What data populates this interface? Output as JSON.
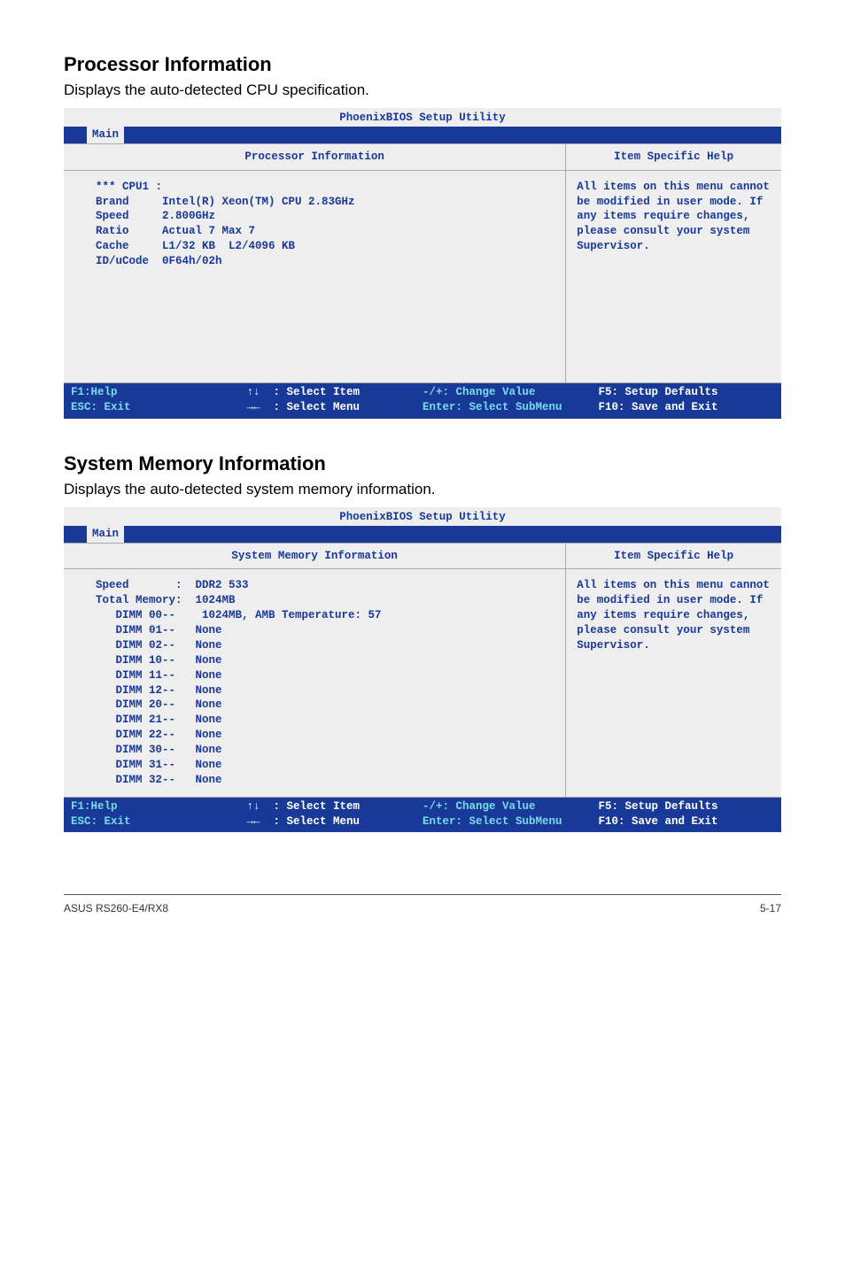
{
  "section1": {
    "heading": "Processor Information",
    "desc": "Displays the auto-detected CPU specification.",
    "bios_title": "PhoenixBIOS Setup Utility",
    "tab": "Main",
    "left_header": "Processor Information",
    "right_header": "Item Specific Help",
    "content": "*** CPU1 :\nBrand     Intel(R) Xeon(TM) CPU 2.83GHz\nSpeed     2.800GHz\nRatio     Actual 7 Max 7\nCache     L1/32 KB  L2/4096 KB\nID/uCode  0F64h/02h\n\n\n\n\n\n\n\n",
    "help": "All items on this menu cannot be modified in user mode. If any items require changes, please consult your system Supervisor."
  },
  "section2": {
    "heading": "System Memory Information",
    "desc": "Displays the auto-detected system memory information.",
    "bios_title": "PhoenixBIOS Setup Utility",
    "tab": "Main",
    "left_header": "System Memory Information",
    "right_header": "Item Specific Help",
    "content": "Speed       :  DDR2 533\nTotal Memory:  1024MB\n   DIMM 00--    1024MB, AMB Temperature: 57\n   DIMM 01--   None\n   DIMM 02--   None\n   DIMM 10--   None\n   DIMM 11--   None\n   DIMM 12--   None\n   DIMM 20--   None\n   DIMM 21--   None\n   DIMM 22--   None\n   DIMM 30--   None\n   DIMM 31--   None\n   DIMM 32--   None",
    "help": "All items on this menu cannot be modified in user mode. If any items require changes, please consult your system Supervisor."
  },
  "footer_keys": {
    "c1a": "F1:Help",
    "c1b": "ESC: Exit",
    "c2a": "↑↓  : Select Item",
    "c2b": "→←  : Select Menu",
    "c3a": "-/+: Change Value",
    "c3b": "Enter: Select SubMenu",
    "c4a": "F5: Setup Defaults",
    "c4b": "F10: Save and Exit"
  },
  "page_footer": {
    "left": "ASUS RS260-E4/RX8",
    "right": "5-17"
  }
}
